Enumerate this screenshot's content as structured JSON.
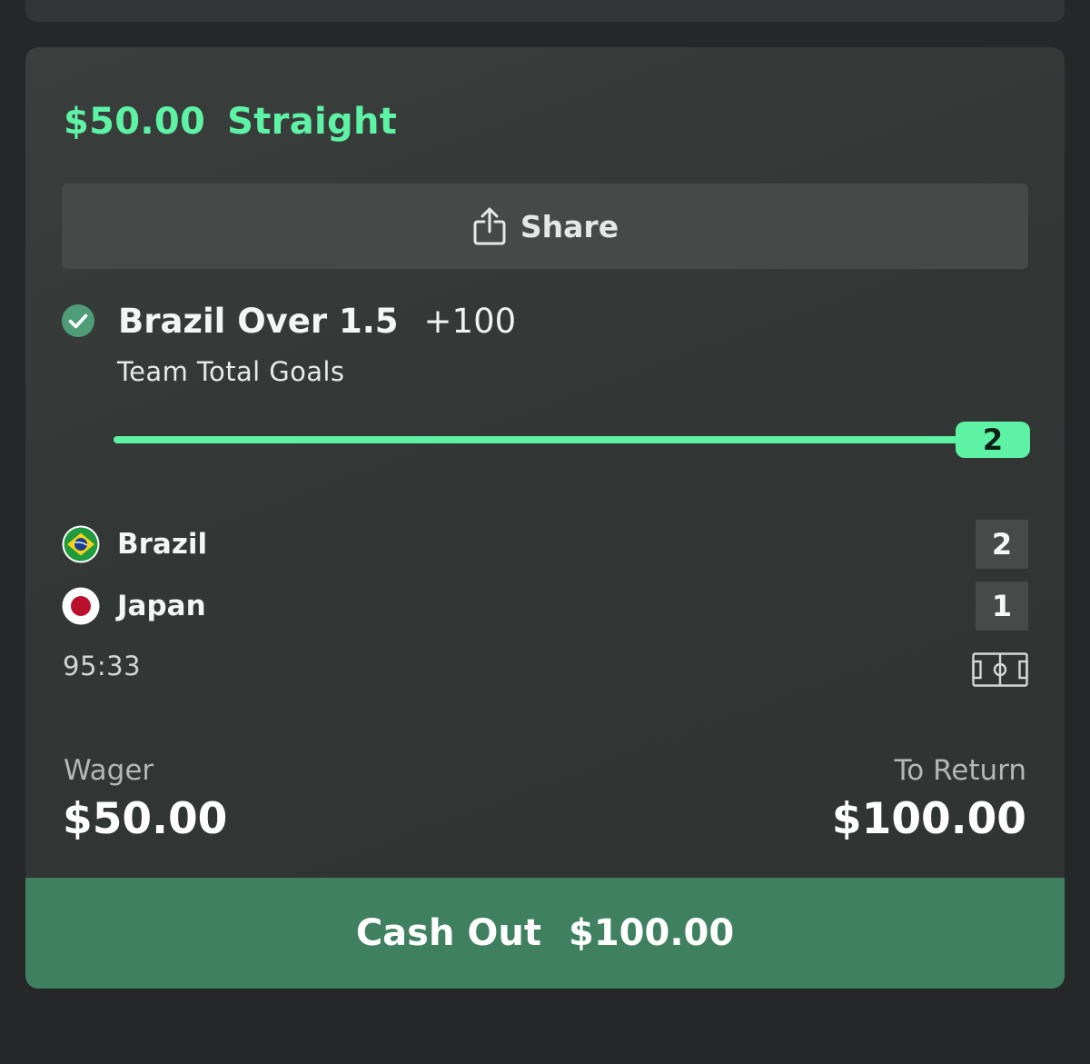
{
  "bet": {
    "stake": "$50.00",
    "type": "Straight",
    "share_label": "Share",
    "selection": {
      "name": "Brazil Over 1.5",
      "odds": "+100",
      "market": "Team Total Goals",
      "status": "won",
      "status_icon": "check-circle-icon"
    },
    "progress": {
      "current": "2",
      "fraction": 1.0
    },
    "match": {
      "home": {
        "name": "Brazil",
        "score": "2",
        "flag_icon": "brazil-flag-icon"
      },
      "away": {
        "name": "Japan",
        "score": "1",
        "flag_icon": "japan-flag-icon"
      },
      "clock": "95:33",
      "field_icon": "soccer-field-icon"
    },
    "wager": {
      "label": "Wager",
      "value": "$50.00"
    },
    "to_return": {
      "label": "To Return",
      "value": "$100.00"
    },
    "cash_out": {
      "label": "Cash Out",
      "amount": "$100.00"
    }
  },
  "colors": {
    "accent": "#5ef2a5",
    "cashout": "#3f8060",
    "background": "#262728",
    "card": "#353938"
  }
}
